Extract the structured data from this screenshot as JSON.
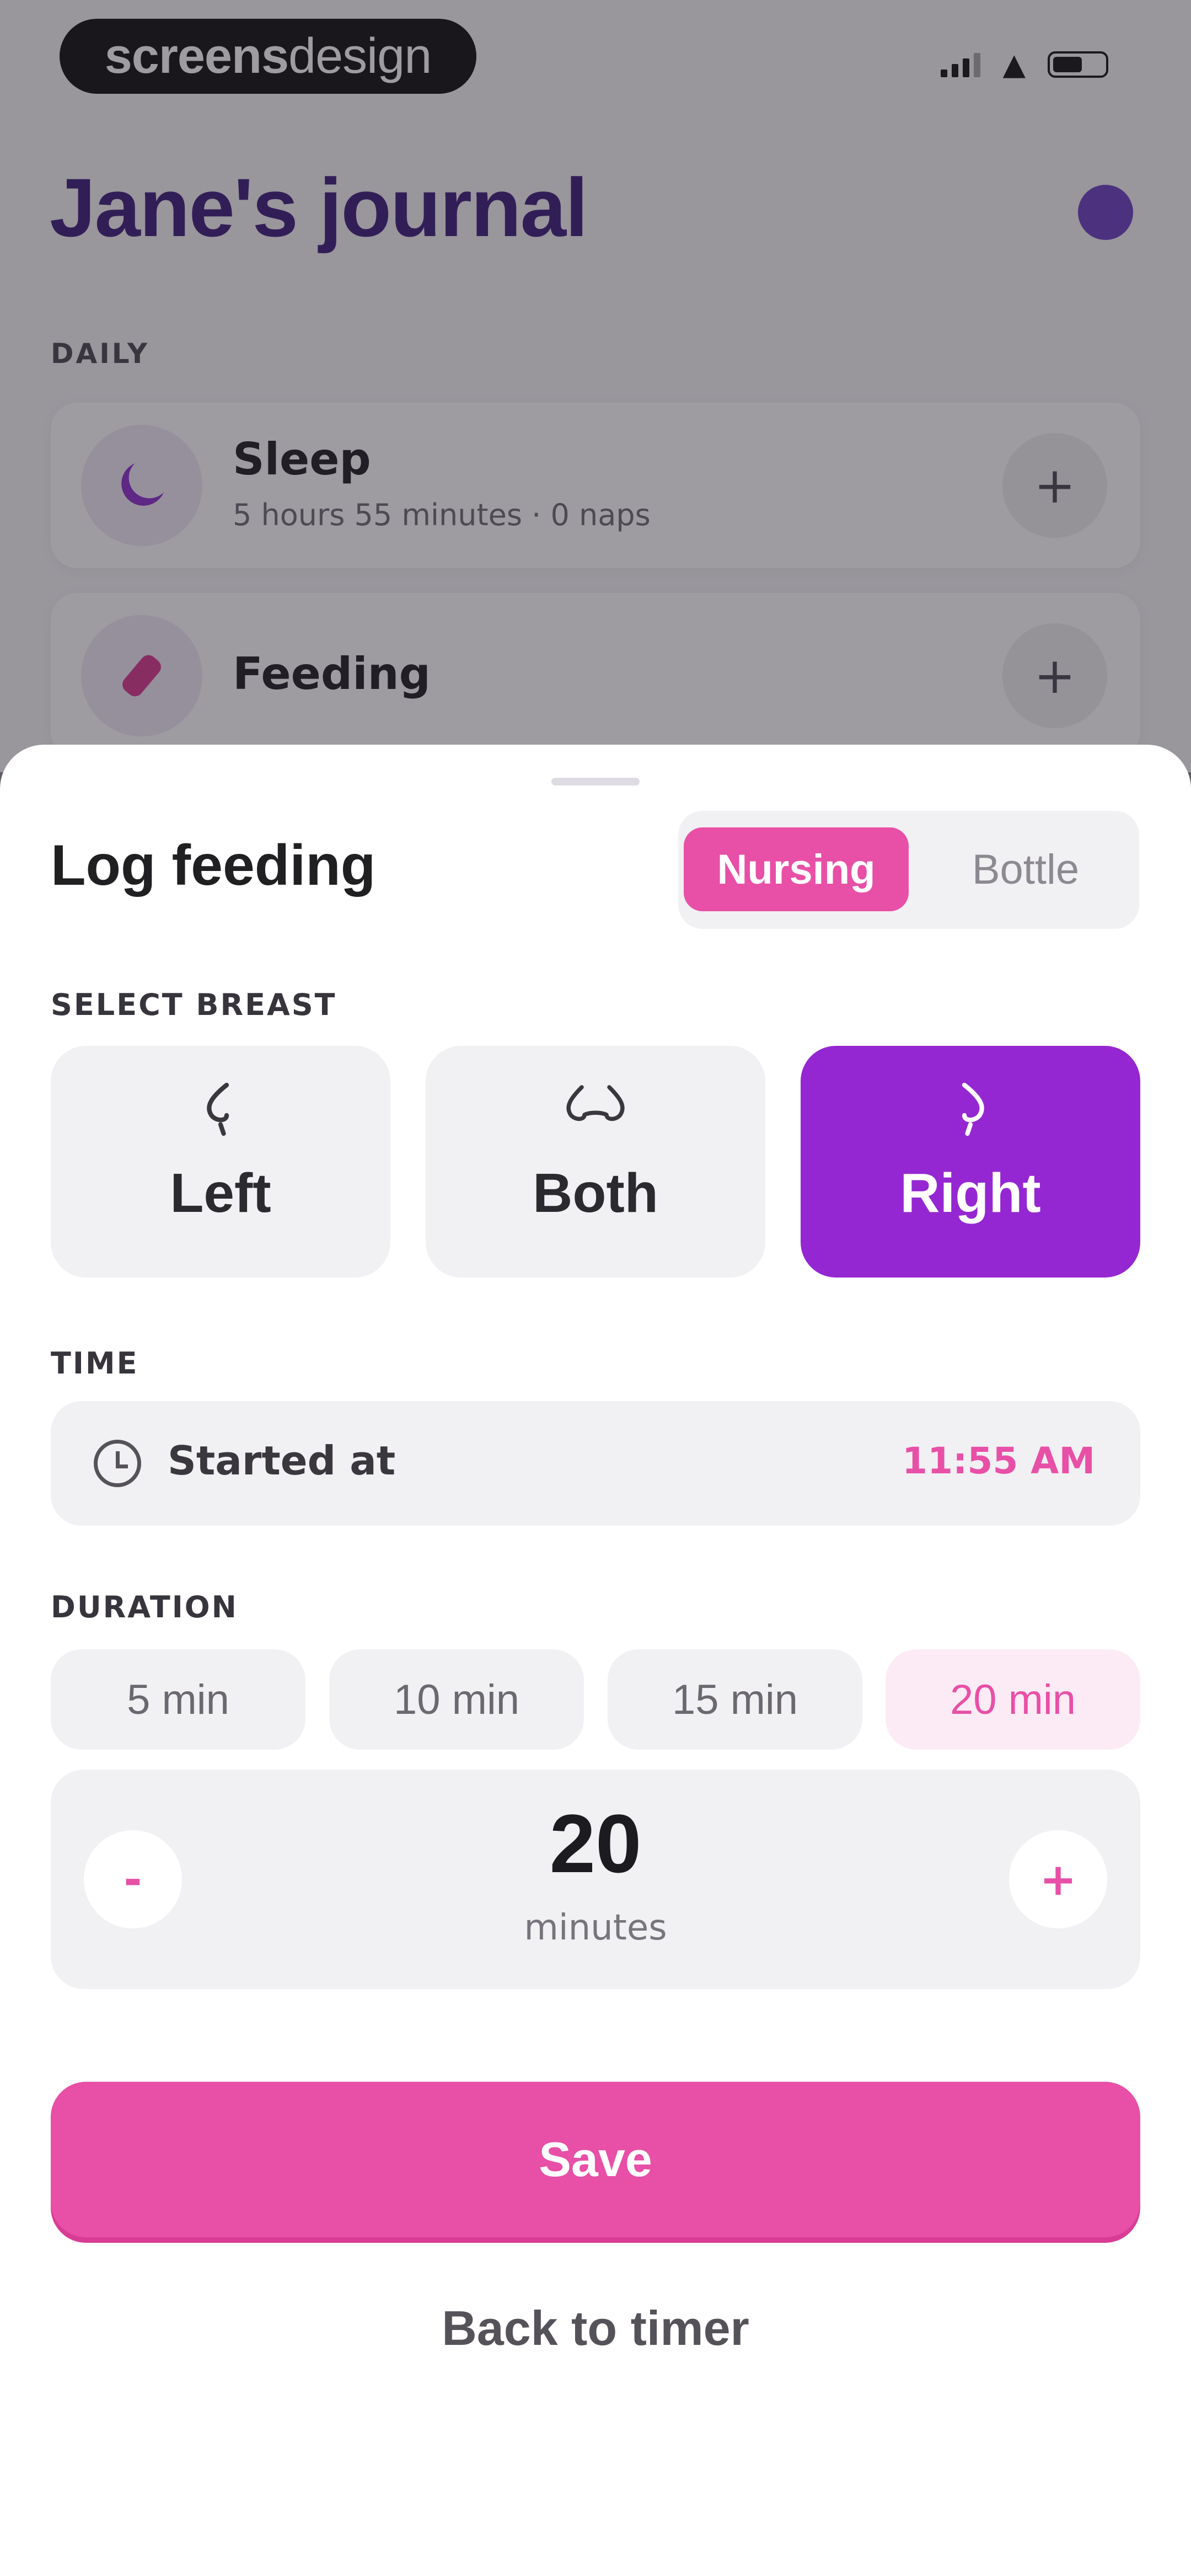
{
  "status_bar": {
    "brand_bold": "screens",
    "brand_light": "design",
    "signal_icon": "signal-icon",
    "wifi_icon": "wifi-icon",
    "battery_icon": "battery-icon"
  },
  "journal": {
    "title": "Jane's journal",
    "section_label": "DAILY",
    "cards": [
      {
        "title": "Sleep",
        "subtitle": "5 hours 55 minutes · 0 naps",
        "icon": "moon-icon",
        "action": "+"
      },
      {
        "title": "Feeding",
        "subtitle": "",
        "icon": "bottle-icon",
        "action": "+"
      }
    ]
  },
  "sheet": {
    "title": "Log feeding",
    "mode_tabs": [
      {
        "label": "Nursing",
        "selected": true
      },
      {
        "label": "Bottle",
        "selected": false
      }
    ],
    "breast_label": "SELECT BREAST",
    "breast_options": [
      {
        "label": "Left",
        "selected": false
      },
      {
        "label": "Both",
        "selected": false
      },
      {
        "label": "Right",
        "selected": true
      }
    ],
    "time_label": "TIME",
    "time_field_label": "Started at",
    "time_value": "11:55 AM",
    "duration_label": "DURATION",
    "duration_presets": [
      {
        "label": "5 min",
        "selected": false
      },
      {
        "label": "10 min",
        "selected": false
      },
      {
        "label": "15 min",
        "selected": false
      },
      {
        "label": "20 min",
        "selected": true
      }
    ],
    "stepper": {
      "minus": "-",
      "value": "20",
      "unit": "minutes",
      "plus": "+"
    },
    "save_label": "Save",
    "back_label": "Back to timer"
  },
  "colors": {
    "accent_pink": "#e84fa6",
    "accent_purple": "#9527d2",
    "title_purple": "#3b1a7a"
  }
}
